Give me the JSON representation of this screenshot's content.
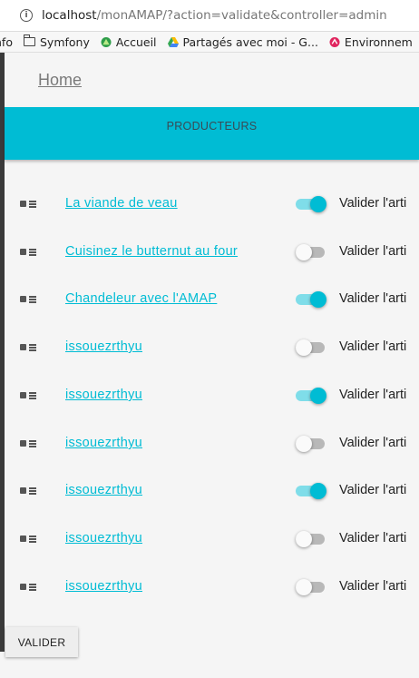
{
  "browser": {
    "url_host": "localhost",
    "url_path": "/monAMAP/?action=validate&controller=admin",
    "bookmarks": [
      {
        "label": "nfo",
        "icon": "none"
      },
      {
        "label": "Symfony",
        "icon": "folder-icon"
      },
      {
        "label": "Accueil",
        "icon": "green-triangle-icon"
      },
      {
        "label": "Partagés avec moi - G...",
        "icon": "google-drive-icon"
      },
      {
        "label": "Environnem",
        "icon": "red-circle-icon"
      }
    ]
  },
  "header": {
    "home_label": "Home",
    "banner_title": "PRODUCTEURS"
  },
  "rows": [
    {
      "title": "La viande de veau",
      "checked": true,
      "label": "Valider l'arti"
    },
    {
      "title": "Cuisinez le butternut au four",
      "checked": false,
      "label": "Valider l'arti"
    },
    {
      "title": "Chandeleur avec l'AMAP",
      "checked": true,
      "label": "Valider l'arti"
    },
    {
      "title": "issouezrthyu",
      "checked": false,
      "label": "Valider l'arti"
    },
    {
      "title": "issouezrthyu",
      "checked": true,
      "label": "Valider l'arti"
    },
    {
      "title": "issouezrthyu",
      "checked": false,
      "label": "Valider l'arti"
    },
    {
      "title": "issouezrthyu",
      "checked": true,
      "label": "Valider l'arti"
    },
    {
      "title": "issouezrthyu",
      "checked": false,
      "label": "Valider l'arti"
    },
    {
      "title": "issouezrthyu",
      "checked": false,
      "label": "Valider l'arti"
    }
  ],
  "actions": {
    "validate_label": "VALIDER"
  },
  "colors": {
    "accent": "#00bcd4",
    "switch_on_track": "#7fdde9",
    "switch_off_track": "#b8b8b8"
  }
}
